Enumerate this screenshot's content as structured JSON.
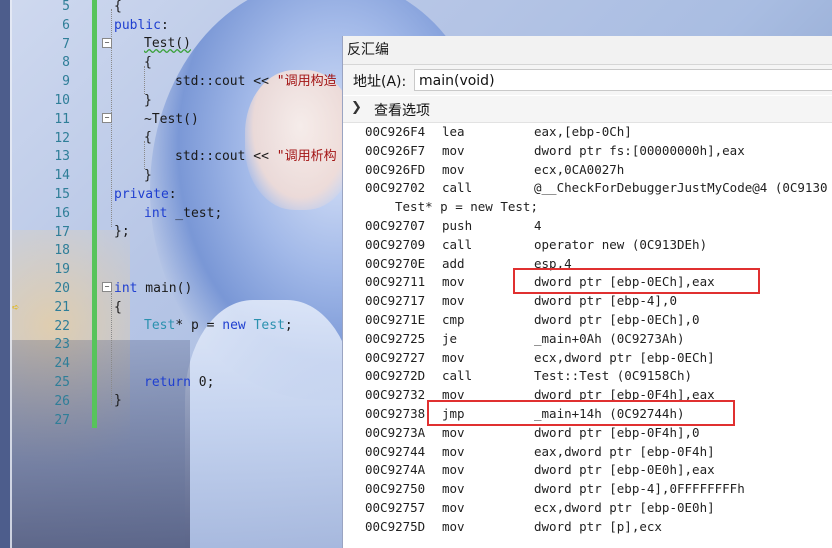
{
  "editor": {
    "line_numbers": [
      "5",
      "6",
      "7",
      "8",
      "9",
      "10",
      "11",
      "12",
      "13",
      "14",
      "15",
      "16",
      "17",
      "18",
      "19",
      "20",
      "21",
      "22",
      "23",
      "24",
      "25",
      "26",
      "27"
    ],
    "lines": {
      "l5": "{",
      "l6_kw": "public",
      "l6_p": ":",
      "l7": "Test()",
      "l8": "{",
      "l9_a": "std::cout << ",
      "l9_s": "\"调用构造",
      "l10": "}",
      "l11": "~Test()",
      "l12": "{",
      "l13_a": "std::cout << ",
      "l13_s": "\"调用析构",
      "l14": "}",
      "l15_kw": "private",
      "l15_p": ":",
      "l16_kw": "int",
      "l16_p": " _test;",
      "l17": "};",
      "l20_kw": "int",
      "l20_p": " main()",
      "l21": "{",
      "l22_t": "Test",
      "l22_a": "* p = ",
      "l22_kw": "new",
      "l22_sp": " ",
      "l22_t2": "Test",
      "l22_e": ";",
      "l25_kw": "return",
      "l25_p": " 0;",
      "l26": "}"
    },
    "current_line_icon": "instruction-pointer-arrow-icon"
  },
  "disasm": {
    "title": "反汇编",
    "address_label": "地址(A):",
    "address_value": "main(void)",
    "options_label": "查看选项",
    "options_icon": "chevron-down-icon",
    "source_line": "Test* p = new Test;",
    "rows_before": [
      {
        "addr": "00C926F4",
        "mnem": "lea",
        "ops": "eax,[ebp-0Ch]"
      },
      {
        "addr": "00C926F7",
        "mnem": "mov",
        "ops": "dword ptr fs:[00000000h],eax"
      },
      {
        "addr": "00C926FD",
        "mnem": "mov",
        "ops": "ecx,0CA0027h"
      },
      {
        "addr": "00C92702",
        "mnem": "call",
        "ops": "@__CheckForDebuggerJustMyCode@4 (0C9130"
      }
    ],
    "rows_after": [
      {
        "addr": "00C92707",
        "mnem": "push",
        "ops": "4"
      },
      {
        "addr": "00C92709",
        "mnem": "call",
        "ops": "operator new (0C913DEh)"
      },
      {
        "addr": "00C9270E",
        "mnem": "add",
        "ops": "esp,4"
      },
      {
        "addr": "00C92711",
        "mnem": "mov",
        "ops": "dword ptr [ebp-0ECh],eax"
      },
      {
        "addr": "00C92717",
        "mnem": "mov",
        "ops": "dword ptr [ebp-4],0"
      },
      {
        "addr": "00C9271E",
        "mnem": "cmp",
        "ops": "dword ptr [ebp-0ECh],0"
      },
      {
        "addr": "00C92725",
        "mnem": "je",
        "ops": "_main+0Ah (0C9273Ah)"
      },
      {
        "addr": "00C92727",
        "mnem": "mov",
        "ops": "ecx,dword ptr [ebp-0ECh]"
      },
      {
        "addr": "00C9272D",
        "mnem": "call",
        "ops": "Test::Test (0C9158Ch)"
      },
      {
        "addr": "00C92732",
        "mnem": "mov",
        "ops": "dword ptr [ebp-0F4h],eax"
      },
      {
        "addr": "00C92738",
        "mnem": "jmp",
        "ops": "_main+14h (0C92744h)"
      },
      {
        "addr": "00C9273A",
        "mnem": "mov",
        "ops": "dword ptr [ebp-0F4h],0"
      },
      {
        "addr": "00C92744",
        "mnem": "mov",
        "ops": "eax,dword ptr [ebp-0F4h]"
      },
      {
        "addr": "00C9274A",
        "mnem": "mov",
        "ops": "dword ptr [ebp-0E0h],eax"
      },
      {
        "addr": "00C92750",
        "mnem": "mov",
        "ops": "dword ptr [ebp-4],0FFFFFFFFh"
      },
      {
        "addr": "00C92757",
        "mnem": "mov",
        "ops": "ecx,dword ptr [ebp-0E0h]"
      },
      {
        "addr": "00C9275D",
        "mnem": "mov",
        "ops": "dword ptr [p],ecx"
      }
    ],
    "highlight_color": "#e03030"
  }
}
